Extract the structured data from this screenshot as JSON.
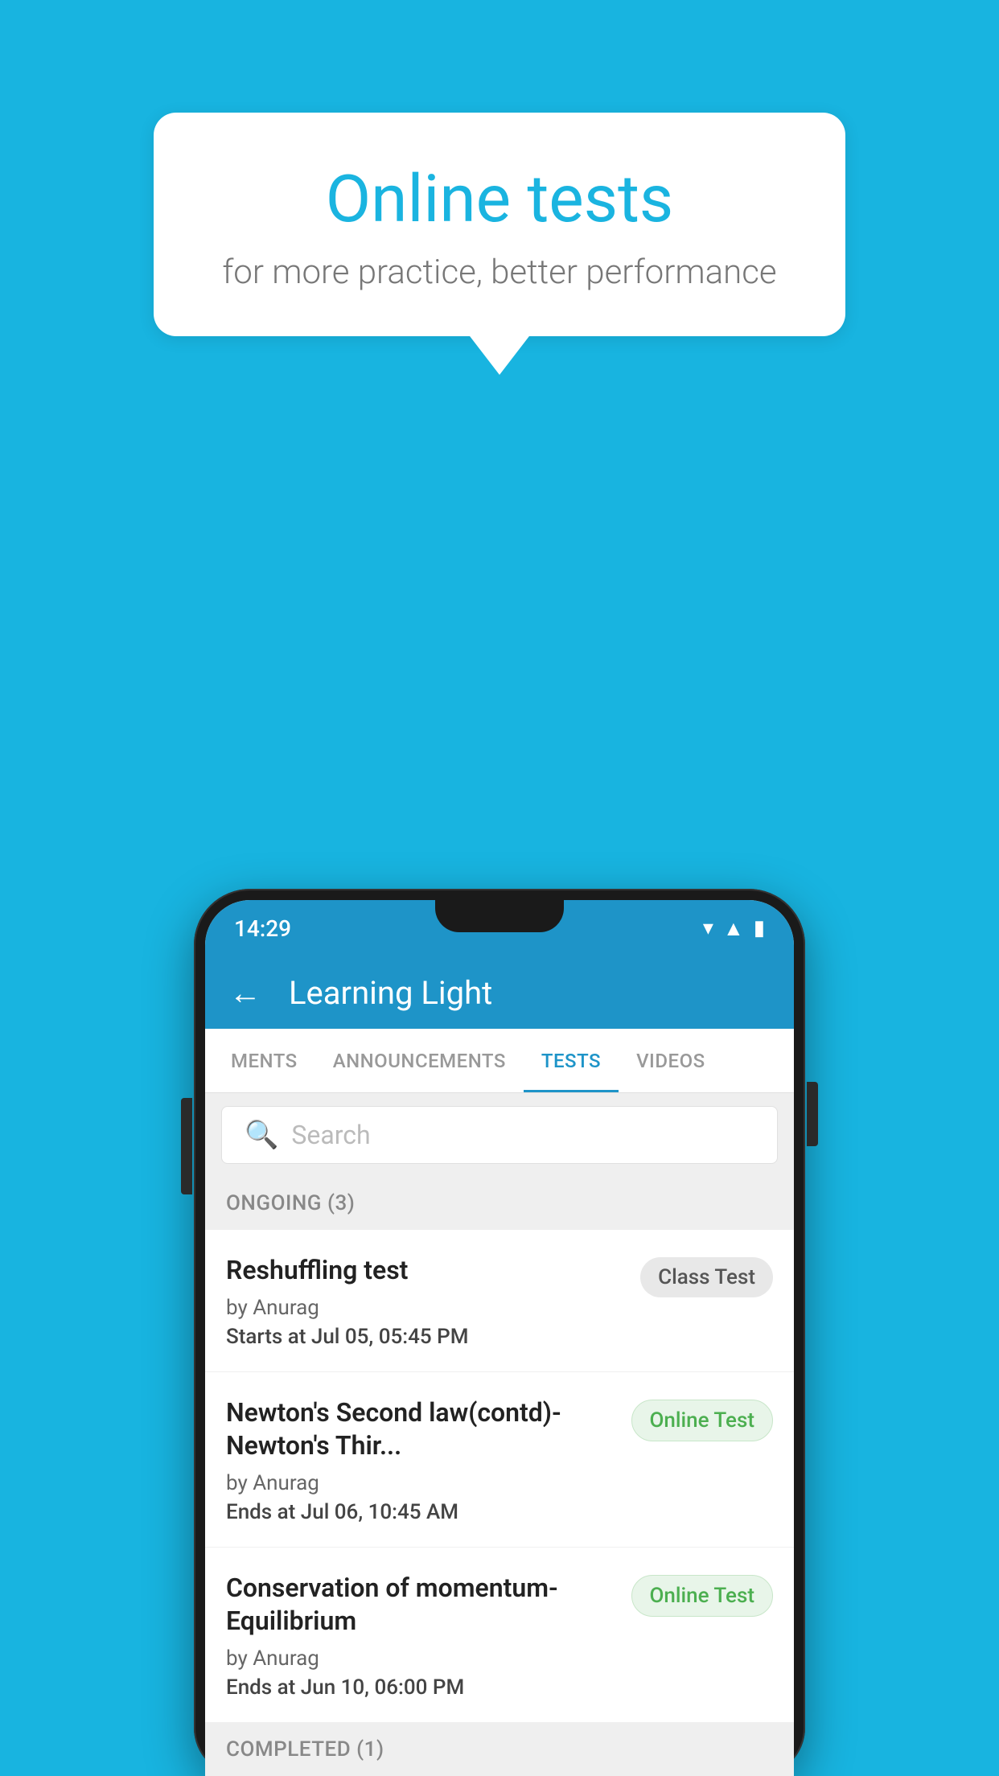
{
  "background": {
    "color": "#18b4e0"
  },
  "speech_bubble": {
    "title": "Online tests",
    "subtitle": "for more practice, better performance"
  },
  "phone": {
    "status_bar": {
      "time": "14:29",
      "icons": [
        "wifi",
        "signal",
        "battery"
      ]
    },
    "top_nav": {
      "back_label": "←",
      "title": "Learning Light"
    },
    "tabs": [
      {
        "label": "MENTS",
        "active": false
      },
      {
        "label": "ANNOUNCEMENTS",
        "active": false
      },
      {
        "label": "TESTS",
        "active": true
      },
      {
        "label": "VIDEOS",
        "active": false
      }
    ],
    "search": {
      "placeholder": "Search"
    },
    "ongoing_section": {
      "label": "ONGOING (3)"
    },
    "test_items": [
      {
        "title": "Reshuffling test",
        "author": "by Anurag",
        "date_label": "Starts at",
        "date_value": "Jul 05, 05:45 PM",
        "badge": "Class Test",
        "badge_type": "class"
      },
      {
        "title": "Newton's Second law(contd)-Newton's Thir...",
        "author": "by Anurag",
        "date_label": "Ends at",
        "date_value": "Jul 06, 10:45 AM",
        "badge": "Online Test",
        "badge_type": "online"
      },
      {
        "title": "Conservation of momentum-Equilibrium",
        "author": "by Anurag",
        "date_label": "Ends at",
        "date_value": "Jun 10, 06:00 PM",
        "badge": "Online Test",
        "badge_type": "online"
      }
    ],
    "completed_section": {
      "label": "COMPLETED (1)"
    }
  }
}
